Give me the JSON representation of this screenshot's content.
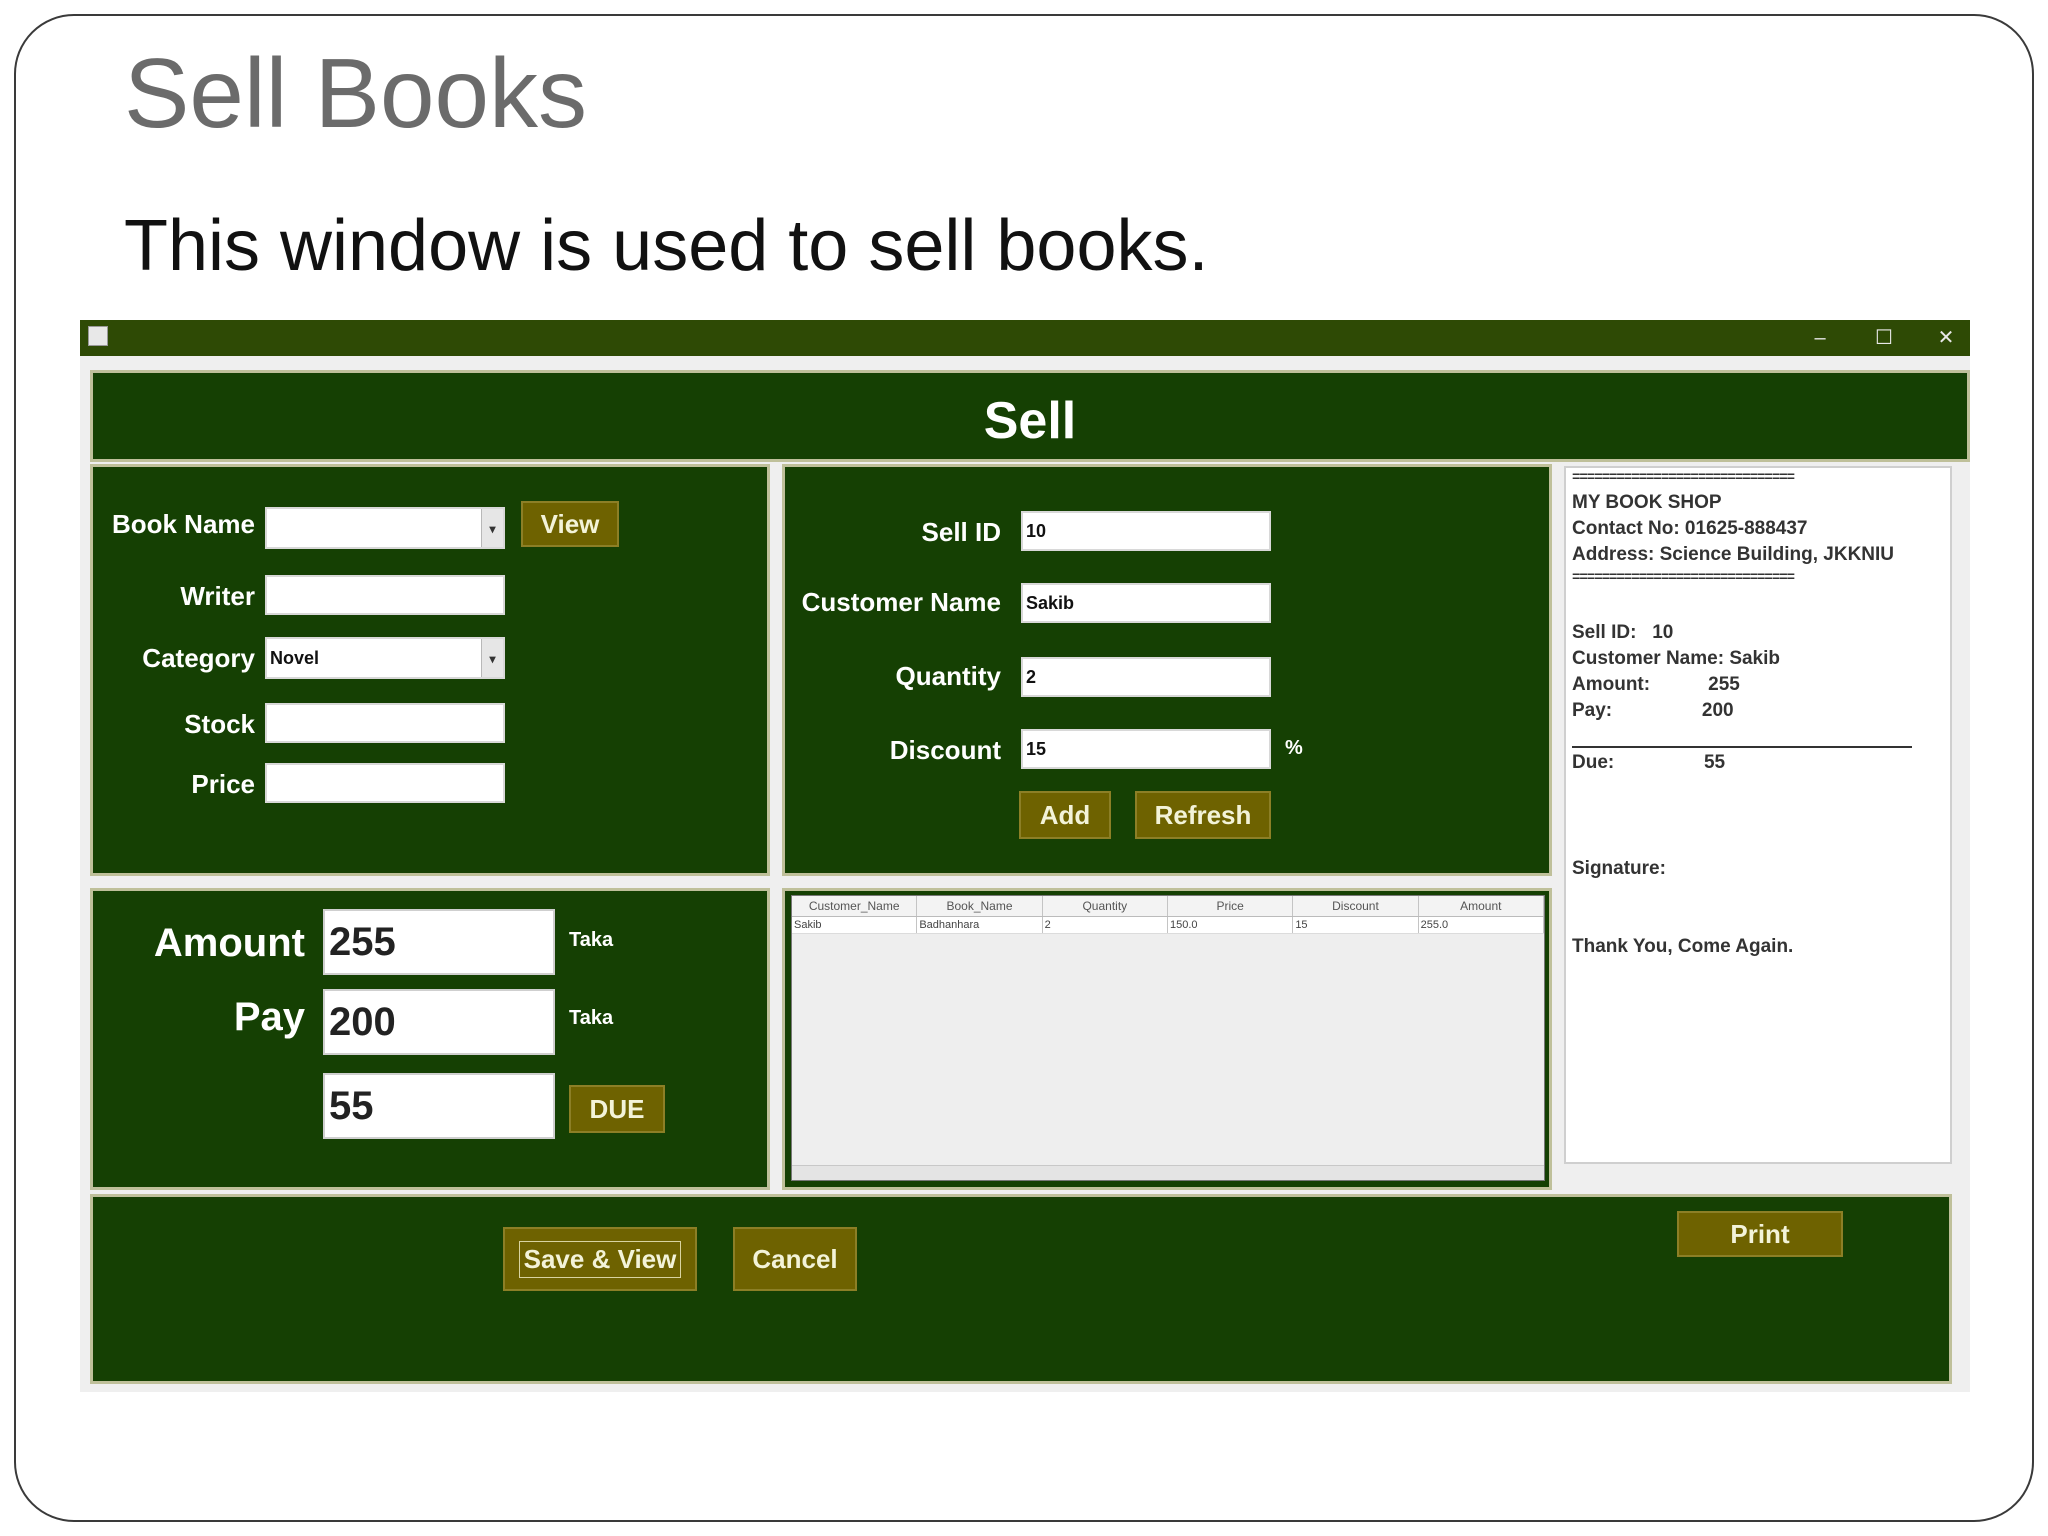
{
  "slide": {
    "title": "Sell Books",
    "subtitle": "This window is used to sell books."
  },
  "window": {
    "controls": {
      "minimize": "–",
      "maximize": "☐",
      "close": "✕"
    }
  },
  "header": {
    "title": "Sell"
  },
  "book_form": {
    "book_name_label": "Book Name",
    "book_name_value": "",
    "view_button": "View",
    "writer_label": "Writer",
    "writer_value": "",
    "category_label": "Category",
    "category_value": "Novel",
    "stock_label": "Stock",
    "stock_value": "",
    "price_label": "Price",
    "price_value": ""
  },
  "order_form": {
    "sell_id_label": "Sell ID",
    "sell_id_value": "10",
    "customer_name_label": "Customer Name",
    "customer_name_value": "Sakib",
    "quantity_label": "Quantity",
    "quantity_value": "2",
    "discount_label": "Discount",
    "discount_value": "15",
    "percent_sign": "%",
    "add_button": "Add",
    "refresh_button": "Refresh"
  },
  "payment": {
    "amount_label": "Amount",
    "amount_value": "255",
    "pay_label": "Pay",
    "pay_value": "200",
    "due_value": "55",
    "currency": "Taka",
    "due_button": "DUE"
  },
  "table": {
    "headers": [
      "Customer_Name",
      "Book_Name",
      "Quantity",
      "Price",
      "Discount",
      "Amount"
    ],
    "rows": [
      [
        "Sakib",
        "Badhanhara",
        "2",
        "150.0",
        "15",
        "255.0"
      ]
    ]
  },
  "receipt": {
    "separator": "==============================",
    "shop_name": "MY BOOK SHOP",
    "contact": "Contact No: 01625-888437",
    "address": "Address: Science Building, JKKNIU",
    "sell_id_line": "Sell ID:   10",
    "customer_line": "Customer Name: Sakib",
    "amount_line": "Amount:           255",
    "pay_line": "Pay:                 200",
    "due_line": "Due:                 55",
    "signature": "Signature:",
    "thanks": "Thank You, Come Again."
  },
  "footer": {
    "save_view_button": "Save & View",
    "cancel_button": "Cancel",
    "print_button": "Print"
  },
  "colors": {
    "panel_bg": "#154003",
    "button_bg": "#6e6200",
    "titlebar": "#2e4a05"
  }
}
